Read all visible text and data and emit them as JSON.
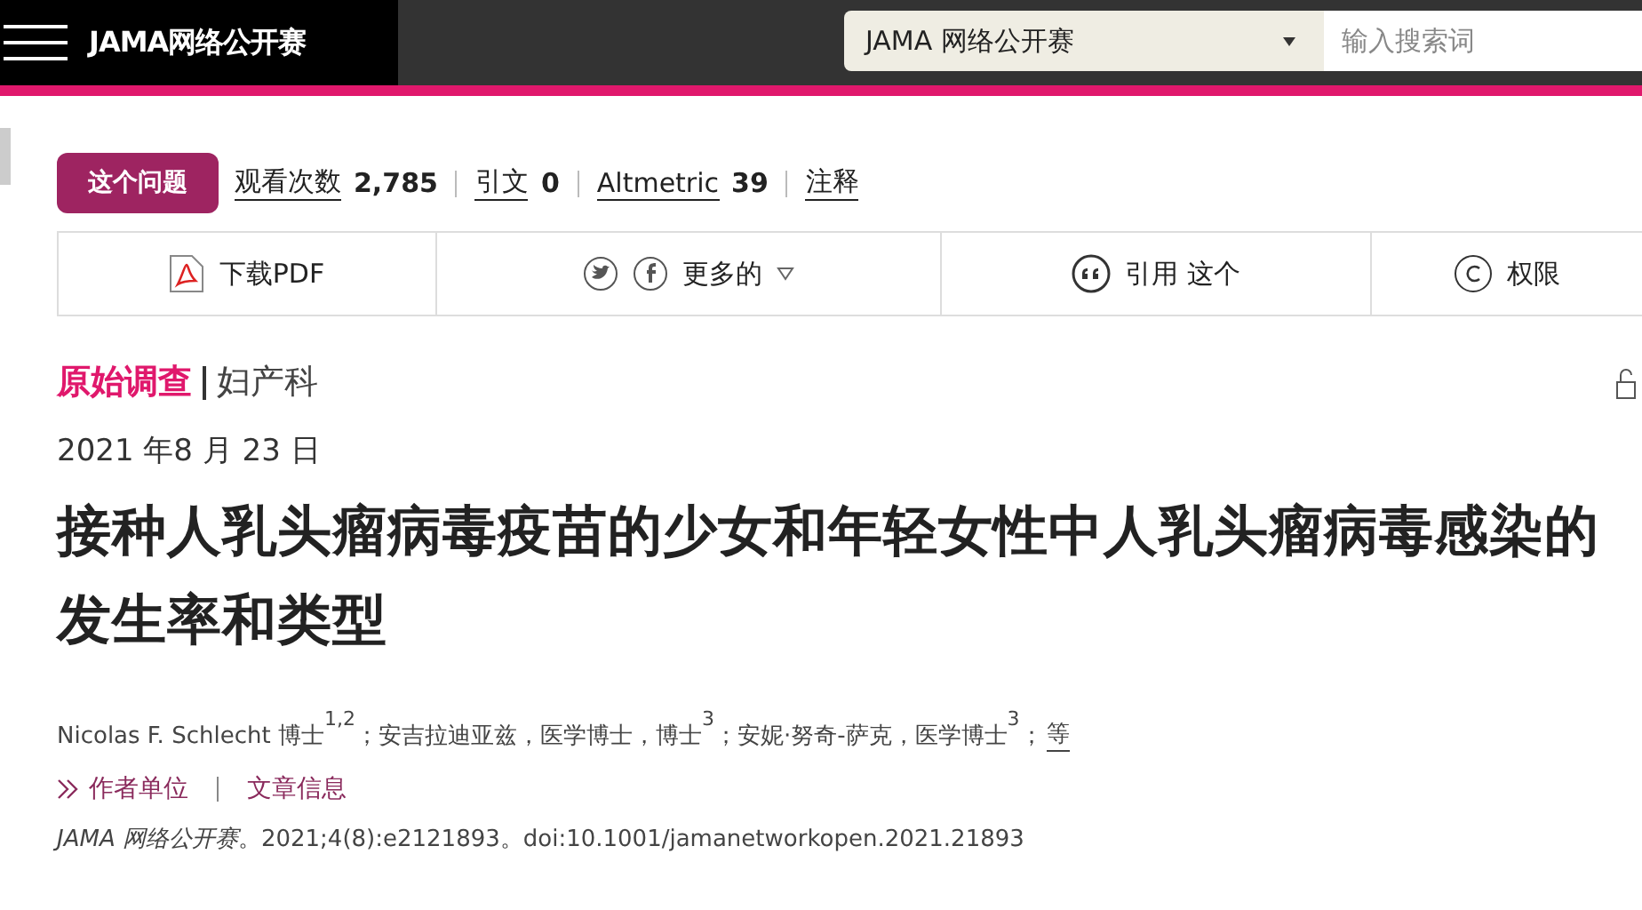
{
  "header": {
    "site_title": "JAMA网络公开赛",
    "journal_select": "JAMA 网络公开赛",
    "search": {
      "placeholder": "输入搜索词"
    }
  },
  "issue_button": "这个问题",
  "metrics": [
    {
      "label": "观看次数",
      "value": "2,785"
    },
    {
      "label": "引文",
      "value": "0"
    },
    {
      "label": "Altmetric",
      "value": "39"
    },
    {
      "label": "注释"
    }
  ],
  "toolbar": [
    {
      "kind": "pdf",
      "label": "下载PDF"
    },
    {
      "kind": "share",
      "label": "更多的"
    },
    {
      "kind": "cite",
      "label": "引用 这个"
    },
    {
      "kind": "permissions",
      "label": "权限"
    }
  ],
  "article": {
    "type": "原始调查",
    "specialty": "妇产科",
    "date": "2021 年8 月 23 日",
    "title": "接种人乳头瘤病毒疫苗的少女和年轻女性中人乳头瘤病毒感染的发生率和类型",
    "authors": "Nicolas F. Schlecht 博士$^{1,2}$；安吉拉迪亚兹，医学博士，博士$^{3}$；安妮·努奇-萨克，医学博士$^{3}$；",
    "authors_more": "等",
    "links": [
      "作者单位",
      "文章信息"
    ],
    "citation": "*JAMA 网络公开赛*。2021;4(8):e2121893。doi:10.1001/jamanetworkopen.2021.21893"
  }
}
